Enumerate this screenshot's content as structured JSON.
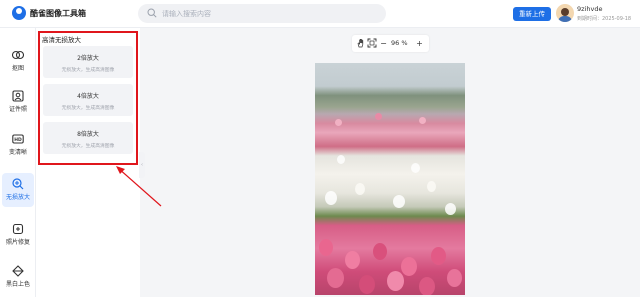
{
  "app": {
    "title": "酷雀图像工具箱"
  },
  "search": {
    "placeholder": "请输入搜索内容"
  },
  "header": {
    "upload_label": "重新上传"
  },
  "user": {
    "name": "9zihvde",
    "expire": "到期时间：2025-09-18"
  },
  "sidebar": {
    "items": [
      {
        "label": "抠图",
        "icon": "cutout-icon",
        "active": false
      },
      {
        "label": "证件照",
        "icon": "id-photo-icon",
        "active": false
      },
      {
        "label": "变清晰",
        "icon": "hd-icon",
        "active": false
      },
      {
        "label": "无损放大",
        "icon": "zoom-in-icon",
        "active": true
      },
      {
        "label": "照片修复",
        "icon": "repair-icon",
        "active": false
      },
      {
        "label": "黑白上色",
        "icon": "colorize-icon",
        "active": false
      }
    ]
  },
  "panel": {
    "title": "高清无损放大",
    "options": [
      {
        "title": "2倍放大",
        "desc": "无损放大，生成高清图像"
      },
      {
        "title": "4倍放大",
        "desc": "无损放大，生成高清图像"
      },
      {
        "title": "8倍放大",
        "desc": "无损放大，生成高清图像"
      }
    ]
  },
  "toolbar": {
    "zoom": "96 %",
    "minus": "−",
    "plus": "+"
  },
  "colors": {
    "accent": "#1e6fe6",
    "highlight": "#e0161c",
    "canvas_bg": "#f4f5f7"
  }
}
